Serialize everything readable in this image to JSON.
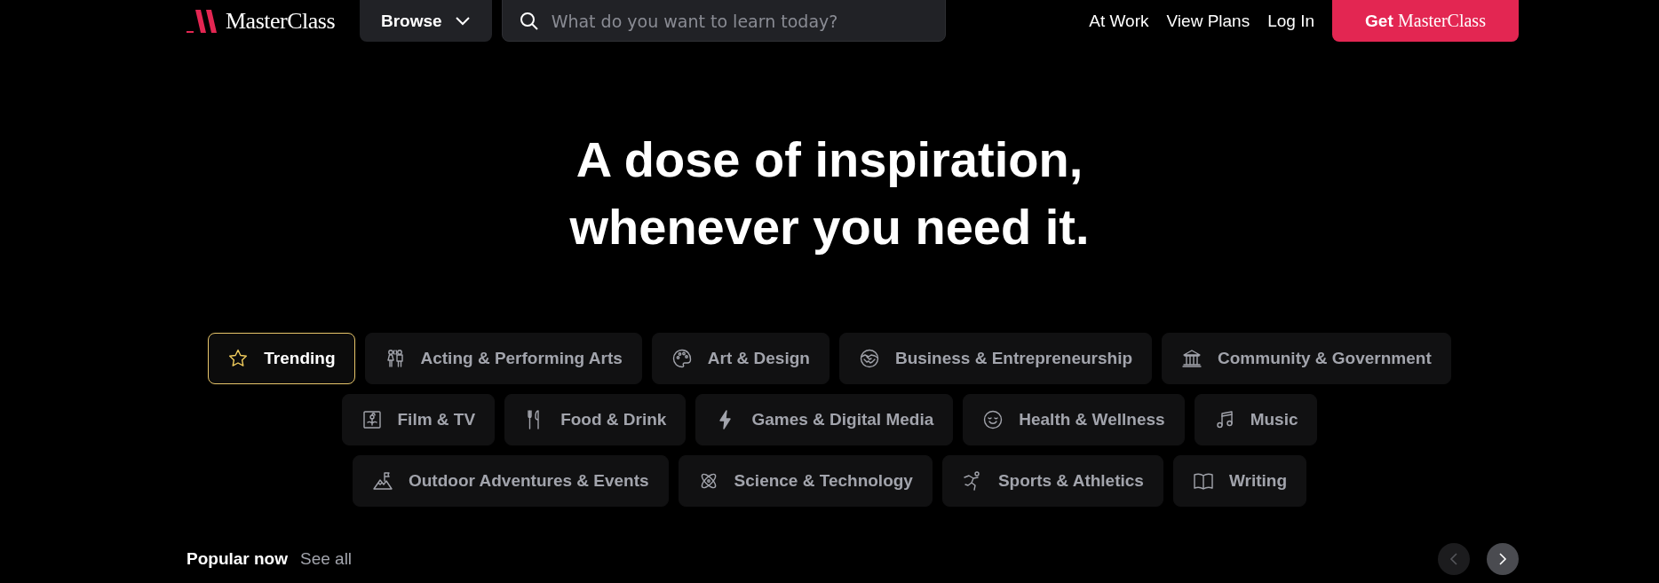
{
  "header": {
    "logo_text": "MasterClass",
    "browse": "Browse",
    "search": {
      "placeholder": "What do you want to learn today?"
    },
    "links": [
      "At Work",
      "View Plans",
      "Log In"
    ],
    "cta": {
      "lead": "Get",
      "brand": "MasterClass"
    }
  },
  "hero": {
    "lines": [
      "A dose of inspiration,",
      "whenever you need it."
    ]
  },
  "category_rows": [
    [
      {
        "label": "Trending",
        "selected": true
      },
      {
        "label": "Acting & Performing Arts",
        "selected": false
      },
      {
        "label": "Art & Design",
        "selected": false
      },
      {
        "label": "Business & Entrepreneurship",
        "selected": false
      },
      {
        "label": "Community & Government",
        "selected": false
      }
    ],
    [
      {
        "label": "Film & TV",
        "selected": false
      },
      {
        "label": "Food & Drink",
        "selected": false
      },
      {
        "label": "Games & Digital Media",
        "selected": false
      },
      {
        "label": "Health & Wellness",
        "selected": false
      },
      {
        "label": "Music",
        "selected": false
      }
    ],
    [
      {
        "label": "Outdoor Adventures & Events",
        "selected": false
      },
      {
        "label": "Science & Technology",
        "selected": false
      },
      {
        "label": "Sports & Athletics",
        "selected": false
      },
      {
        "label": "Writing",
        "selected": false
      }
    ]
  ],
  "section": {
    "title": "Popular now",
    "link": "See all",
    "prev": {
      "disabled": true
    },
    "next": {
      "disabled": false
    }
  }
}
